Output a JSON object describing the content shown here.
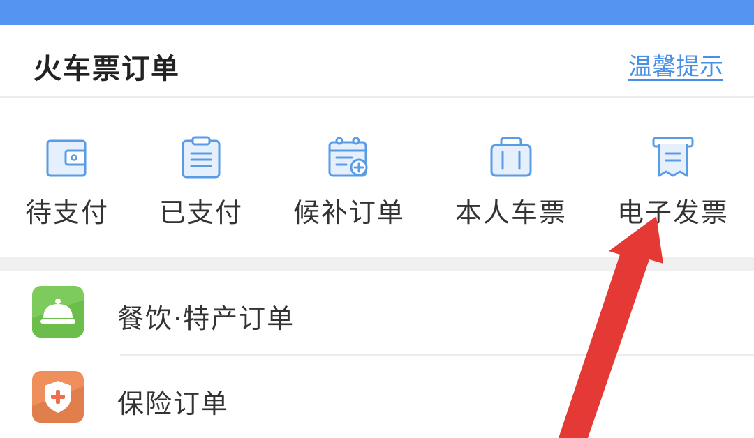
{
  "header": {
    "title": "火车票订单",
    "tip_link": "温馨提示"
  },
  "tabs": [
    {
      "label": "待支付",
      "icon": "wallet-icon"
    },
    {
      "label": "已支付",
      "icon": "clipboard-icon"
    },
    {
      "label": "候补订单",
      "icon": "calendar-add-icon"
    },
    {
      "label": "本人车票",
      "icon": "suitcase-icon"
    },
    {
      "label": "电子发票",
      "icon": "receipt-icon"
    }
  ],
  "list": [
    {
      "label": "餐饮·特产订单",
      "icon": "service-bell-icon"
    },
    {
      "label": "保险订单",
      "icon": "shield-plus-icon"
    }
  ],
  "colors": {
    "topbar": "#5594f0",
    "link": "#4a8fe6",
    "icon_stroke": "#5a9be6",
    "icon_fill": "#e6f0fc",
    "food_green": "#7ccb5c",
    "insurance_orange": "#ee8f5c",
    "annotation_arrow": "#e53935"
  }
}
